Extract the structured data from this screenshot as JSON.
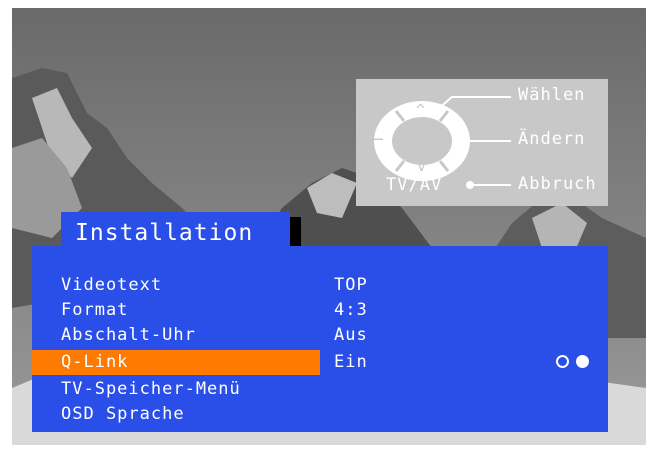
{
  "legend": {
    "select_label": "Wählen",
    "change_label": "Ändern",
    "cancel_label": "Abbruch",
    "tvav_label": "TV/AV",
    "up_symbol": "^",
    "down_symbol": "v",
    "minus_symbol": "−",
    "plus_symbol": "+"
  },
  "menu": {
    "title": "Installation",
    "items": [
      {
        "label": "Videotext",
        "value": "TOP"
      },
      {
        "label": "Format",
        "value": "4:3"
      },
      {
        "label": "Abschalt-Uhr",
        "value": "Aus"
      },
      {
        "label": "Q-Link",
        "value": "Ein"
      },
      {
        "label": "TV-Speicher-Menü",
        "value": ""
      },
      {
        "label": "OSD Sprache",
        "value": ""
      }
    ],
    "selected_index": 3
  },
  "colors": {
    "menu_blue": "#2a4ee8",
    "highlight_orange": "#ff7a00",
    "legend_gray": "#c8c8c8"
  }
}
